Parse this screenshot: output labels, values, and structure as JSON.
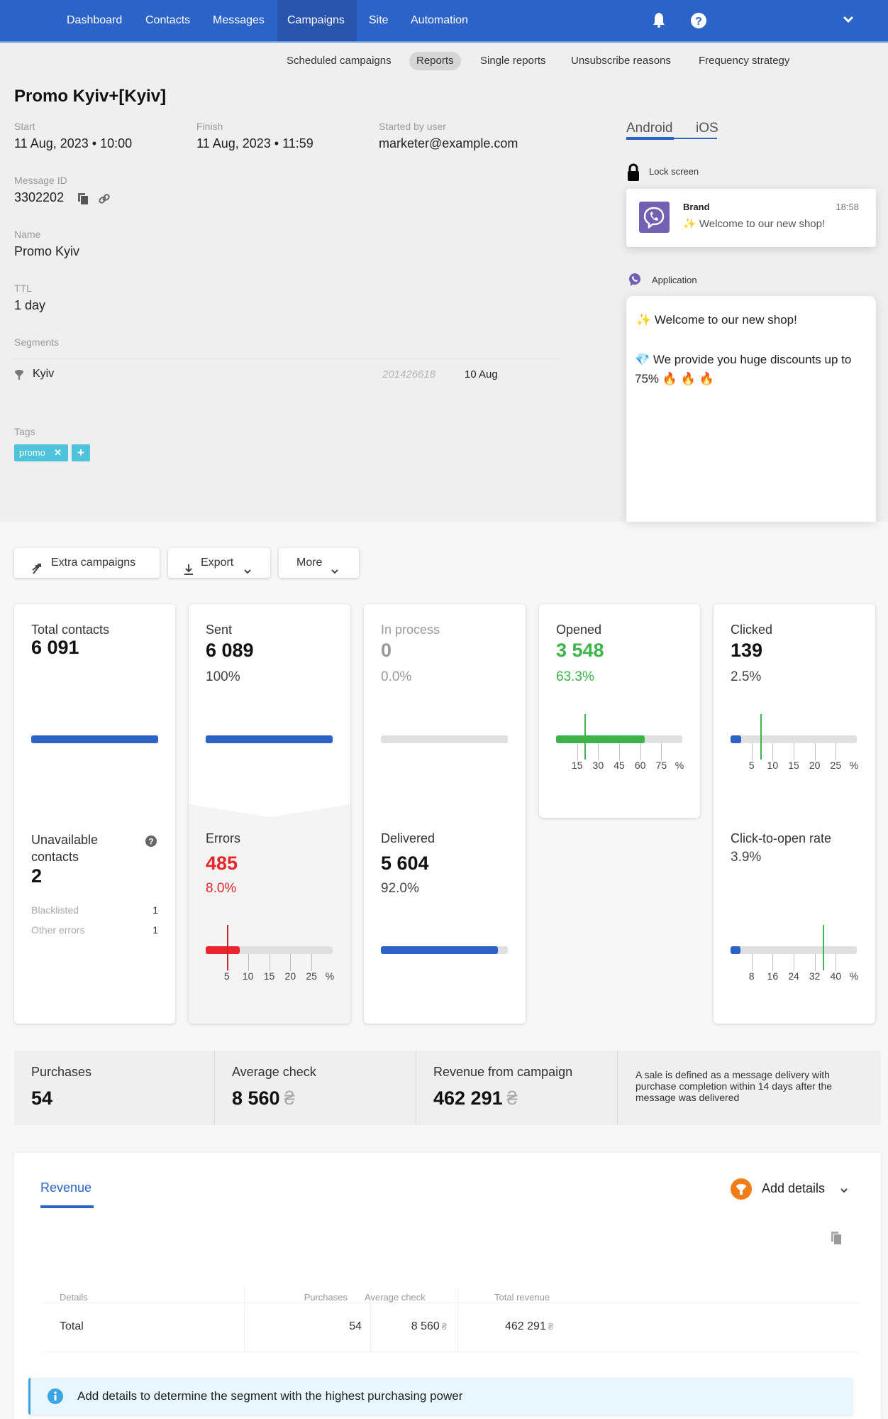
{
  "topnav": {
    "items": [
      {
        "label": "Dashboard",
        "active": false
      },
      {
        "label": "Contacts",
        "active": false
      },
      {
        "label": "Messages",
        "active": false
      },
      {
        "label": "Campaigns",
        "active": true
      },
      {
        "label": "Site",
        "active": false
      },
      {
        "label": "Automation",
        "active": false
      }
    ],
    "icons": [
      "bell-icon",
      "help-icon",
      "chevron-down-icon"
    ]
  },
  "subnav": {
    "items": [
      {
        "label": "Scheduled campaigns",
        "active": false
      },
      {
        "label": "Reports",
        "active": true
      },
      {
        "label": "Single reports",
        "active": false
      },
      {
        "label": "Unsubscribe reasons",
        "active": false
      },
      {
        "label": "Frequency strategy",
        "active": false
      }
    ]
  },
  "campaign": {
    "title": "Promo Kyiv+[Kyiv]",
    "start_label": "Start",
    "start_value": "11 Aug, 2023 • 10:00",
    "finish_label": "Finish",
    "finish_value": "11 Aug, 2023 • 11:59",
    "started_by_label": "Started by user",
    "started_by_value": "marketer@example.com",
    "message_id_label": "Message ID",
    "message_id_value": "3302202",
    "name_label": "Name",
    "name_value": "Promo Kyiv",
    "ttl_label": "TTL",
    "ttl_value": "1 day",
    "segments_label": "Segments",
    "segments": [
      {
        "name": "Kyiv",
        "id": "201426618",
        "date": "10 Aug"
      }
    ],
    "tags_label": "Tags",
    "tags": [
      "promo"
    ],
    "add_tag": "+"
  },
  "preview": {
    "tabs": [
      {
        "label": "Android",
        "active": true
      },
      {
        "label": "iOS",
        "active": false
      }
    ],
    "lock_screen_label": "Lock screen",
    "lock_notification": {
      "sender": "Brand",
      "time": "18:58",
      "text": "✨ Welcome to our new shop!"
    },
    "application_label": "Application",
    "app_message": {
      "line1": "✨ Welcome to our new shop!",
      "line2": "💎 We provide you huge discounts up to 75% 🔥 🔥 🔥"
    },
    "brand_color": "#7360b2"
  },
  "actions": {
    "extra_campaigns": "Extra campaigns",
    "export": "Export",
    "more": "More"
  },
  "funnel": {
    "total_contacts": {
      "label": "Total contacts",
      "value": "6 091",
      "fill": 1.0
    },
    "sent": {
      "label": "Sent",
      "value": "6 089",
      "percent": "100%",
      "fill": 1.0
    },
    "in_process": {
      "label": "In process",
      "value": "0",
      "percent": "0.0%",
      "fill": 0.0
    },
    "opened": {
      "label": "Opened",
      "value": "3 548",
      "percent": "63.3%",
      "fill_percent": 63.3,
      "benchmark_percent": 20,
      "scale_max": 90,
      "ticks": [
        "15",
        "30",
        "45",
        "60",
        "75"
      ],
      "unit": "%"
    },
    "clicked": {
      "label": "Clicked",
      "value": "139",
      "percent": "2.5%",
      "fill_percent": 2.5,
      "benchmark_percent": 7,
      "scale_max": 30,
      "ticks": [
        "5",
        "10",
        "15",
        "20",
        "25"
      ],
      "unit": "%"
    },
    "unavailable": {
      "label": "Unavailable contacts",
      "value": "2",
      "rows": [
        {
          "label": "Blacklisted",
          "value": "1"
        },
        {
          "label": "Other errors",
          "value": "1"
        }
      ]
    },
    "errors": {
      "label": "Errors",
      "value": "485",
      "percent": "8.0%",
      "fill_percent": 8.0,
      "benchmark_percent": 5,
      "scale_max": 30,
      "ticks": [
        "5",
        "10",
        "15",
        "20",
        "25"
      ],
      "unit": "%"
    },
    "delivered": {
      "label": "Delivered",
      "value": "5 604",
      "percent": "92.0%",
      "fill": 0.92
    },
    "cto": {
      "label": "Click-to-open rate",
      "percent": "3.9%",
      "fill_percent": 3.9,
      "benchmark_percent": 35,
      "scale_max": 48,
      "ticks": [
        "8",
        "16",
        "24",
        "32",
        "40"
      ],
      "unit": "%"
    }
  },
  "colors": {
    "primary": "#2b63c8",
    "green": "#3cb44a",
    "red": "#e8262b",
    "tag": "#4fc3dc",
    "orange": "#f07d1a"
  },
  "sales": {
    "purchases_label": "Purchases",
    "purchases_value": "54",
    "avg_check_label": "Average check",
    "avg_check_value": "8 560",
    "revenue_label": "Revenue from campaign",
    "revenue_value": "462 291",
    "currency": "₴",
    "note": "A sale is defined as a message delivery with purchase completion within 14 days after the message was delivered"
  },
  "revenue": {
    "tab_label": "Revenue",
    "add_details": "Add details",
    "table": {
      "headers": [
        "Details",
        "Purchases",
        "Average check",
        "Total revenue"
      ],
      "rows": [
        {
          "details": "Total",
          "purchases": "54",
          "avg_check": "8 560",
          "total_revenue": "462 291"
        }
      ]
    },
    "info_text": "Add details to determine the segment with the highest purchasing power"
  }
}
